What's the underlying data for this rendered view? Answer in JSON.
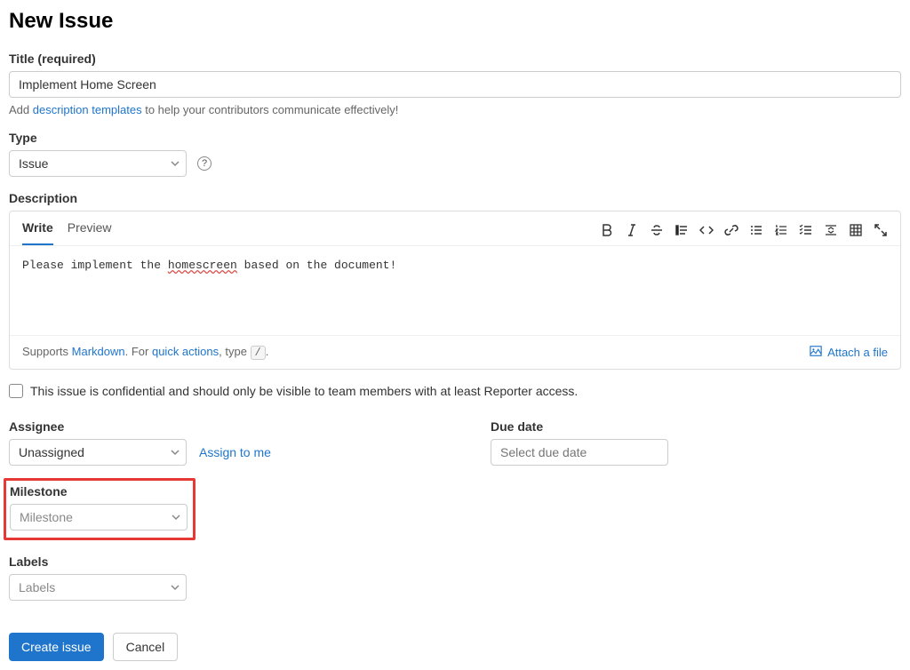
{
  "page": {
    "title": "New Issue"
  },
  "title_field": {
    "label": "Title (required)",
    "value": "Implement Home Screen"
  },
  "template_hint": {
    "prefix": "Add ",
    "link": "description templates",
    "suffix": " to help your contributors communicate effectively!"
  },
  "type_field": {
    "label": "Type",
    "value": "Issue"
  },
  "description": {
    "label": "Description",
    "tabs": {
      "write": "Write",
      "preview": "Preview"
    },
    "body_prefix": "Please implement the ",
    "body_error": "homescreen",
    "body_suffix": " based on the document!",
    "footer_supports": "Supports ",
    "footer_markdown": "Markdown",
    "footer_for": ". For ",
    "footer_quick": "quick actions",
    "footer_type": ", type ",
    "footer_key": "/",
    "footer_dot": ".",
    "attach": "Attach a file"
  },
  "confidential": {
    "label": "This issue is confidential and should only be visible to team members with at least Reporter access."
  },
  "assignee": {
    "label": "Assignee",
    "value": "Unassigned",
    "assign_link": "Assign to me"
  },
  "due_date": {
    "label": "Due date",
    "placeholder": "Select due date"
  },
  "milestone": {
    "label": "Milestone",
    "placeholder": "Milestone"
  },
  "labels": {
    "label": "Labels",
    "placeholder": "Labels"
  },
  "actions": {
    "create": "Create issue",
    "cancel": "Cancel"
  }
}
